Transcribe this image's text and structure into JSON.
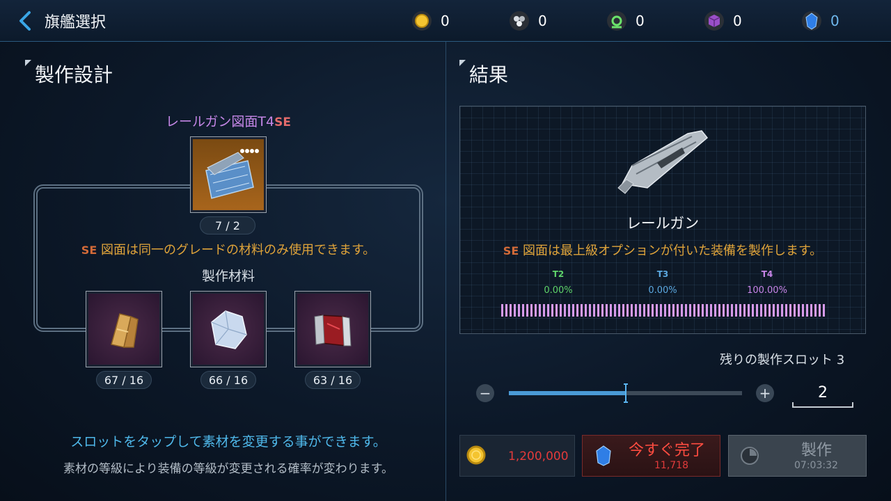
{
  "header": {
    "title": "旗艦選択",
    "currencies": [
      {
        "icon": "gold-coin-icon",
        "value": "0"
      },
      {
        "icon": "metal-ore-icon",
        "value": "0"
      },
      {
        "icon": "green-crystal-icon",
        "value": "0"
      },
      {
        "icon": "purple-cube-icon",
        "value": "0"
      },
      {
        "icon": "blue-gem-icon",
        "value": "0"
      }
    ]
  },
  "left": {
    "section_title": "製作設計",
    "blueprint_name": "レールガン図面T4",
    "blueprint_se": "SE",
    "blueprint_count": "7 / 2",
    "se_tag": "SE",
    "se_note": "図面は同一のグレードの材料のみ使用できます。",
    "materials_label": "製作材料",
    "materials": [
      {
        "icon": "gold-bar-material-icon",
        "count": "67 / 16"
      },
      {
        "icon": "ice-crystal-material-icon",
        "count": "66 / 16"
      },
      {
        "icon": "red-alloy-material-icon",
        "count": "63 / 16"
      }
    ],
    "hint_primary": "スロットをタップして素材を変更する事ができます。",
    "hint_secondary": "素材の等級により装備の等級が変更される確率が変わります。"
  },
  "right": {
    "section_title": "結果",
    "result_name": "レールガン",
    "se_tag": "SE",
    "se_note": "図面は最上級オプションが付いた装備を製作します。",
    "tiers": [
      {
        "label": "T2",
        "percent": "0.00%",
        "color": "#5fd36a"
      },
      {
        "label": "T3",
        "percent": "0.00%",
        "color": "#5ba8e0"
      },
      {
        "label": "T4",
        "percent": "100.00%",
        "color": "#c785e8"
      }
    ],
    "slots_remaining": "残りの製作スロット 3",
    "quantity": "2",
    "slider_fraction": 0.5,
    "cost_value": "1,200,000",
    "finish_now_label": "今すぐ完了",
    "finish_now_cost": "11,718",
    "craft_label": "製作",
    "craft_time": "07:03:32"
  }
}
